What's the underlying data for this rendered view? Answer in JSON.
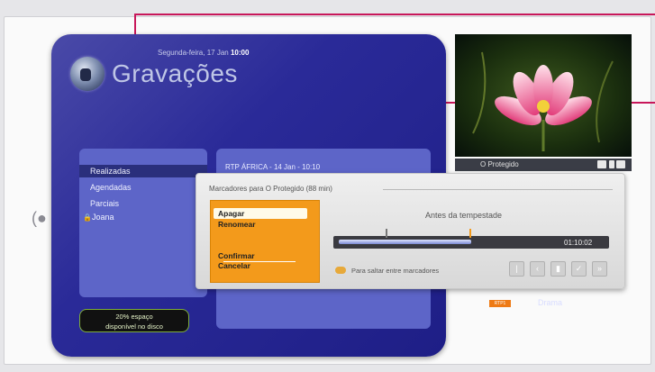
{
  "header": {
    "date_label": "Segunda-feira, 17 Jan",
    "time_label": "10:00",
    "title": "Gravações"
  },
  "sidebar": {
    "items": [
      {
        "label": "Realizadas",
        "selected": true
      },
      {
        "label": "Agendadas",
        "selected": false
      },
      {
        "label": "Parciais",
        "selected": false
      },
      {
        "label": "Joana",
        "selected": false
      }
    ],
    "disk_badge_line1": "20% espaço",
    "disk_badge_line2": "disponível no disco"
  },
  "recording_list": {
    "header": "RTP ÁFRICA - 14 Jan - 10:10"
  },
  "preview": {
    "channel_label": "O Protegido"
  },
  "popup": {
    "title": "Marcadores para O Protegido (88 min)",
    "menu_items": [
      "Apagar",
      "Renomear",
      "Confirmar",
      "Cancelar"
    ],
    "selected_menu_item": "Apagar",
    "marker_label": "Antes da tempestade",
    "time_readout": "01:10:02",
    "progress_fraction": 0.5,
    "hint": "Para saltar entre marcadores"
  },
  "program_row": {
    "tag": "RTP1",
    "name": "Drama"
  },
  "colors": {
    "panel_blue": "#2a2a98",
    "menu_orange": "#f39a1b",
    "callout_magenta": "#c8175a"
  }
}
